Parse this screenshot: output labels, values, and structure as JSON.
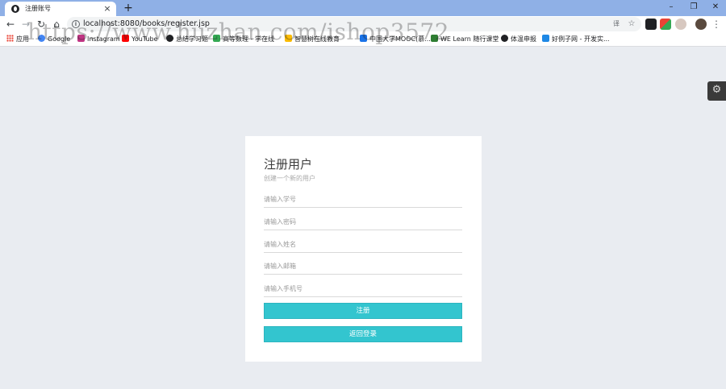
{
  "browser": {
    "tab_title": "注册账号",
    "tab_close": "×",
    "new_tab": "+",
    "window_controls": {
      "minimize": "–",
      "restore": "❐",
      "close": "✕"
    },
    "nav": {
      "back": "←",
      "forward": "→",
      "reload": "↻",
      "home": "⌂"
    },
    "url": "localhost:8080/books/register.jsp",
    "url_info": "i",
    "translate_icon": "译",
    "bookmark_star": "☆",
    "menu": "⋮",
    "bookmarks": [
      {
        "label": "应用",
        "icon": "apps-grid-icon",
        "color": "#ea4335"
      },
      {
        "label": "Google",
        "icon": "google-icon",
        "color": "#4285f4"
      },
      {
        "label": "Instagram",
        "icon": "instagram-icon",
        "color": "#c13584"
      },
      {
        "label": "YouTube",
        "icon": "youtube-icon",
        "color": "#ff0000"
      },
      {
        "label": "总结学习题",
        "icon": "globe-icon",
        "color": "#202124"
      },
      {
        "label": "高等数理 - 学在线",
        "icon": "bookmark-icon",
        "color": "#34a853"
      },
      {
        "label": "智慧树在线教育",
        "icon": "bookmark-icon",
        "color": "#fbbc05"
      },
      {
        "label": "中国大学MOOC(慕...",
        "icon": "mooc-icon",
        "color": "#1a73e8"
      },
      {
        "label": "WE Learn 随行课堂",
        "icon": "welearn-icon",
        "color": "#2e7d32"
      },
      {
        "label": "体温申报",
        "icon": "globe-icon",
        "color": "#202124"
      },
      {
        "label": "好例子网 - 开发实...",
        "icon": "m-icon",
        "color": "#1e88e5"
      }
    ]
  },
  "page": {
    "settings_icon": "⚙",
    "form": {
      "title": "注册用户",
      "subtitle": "创建一个新的用户",
      "fields": [
        {
          "placeholder": "请输入学号",
          "value": ""
        },
        {
          "placeholder": "请输入密码",
          "value": ""
        },
        {
          "placeholder": "请输入姓名",
          "value": ""
        },
        {
          "placeholder": "请输入邮箱",
          "value": ""
        },
        {
          "placeholder": "请输入手机号",
          "value": ""
        }
      ],
      "register_button": "注册",
      "back_button": "返回登录"
    },
    "accent_color": "#33c5cf"
  },
  "watermark": "https://www.huzhan.com/ishop3572"
}
